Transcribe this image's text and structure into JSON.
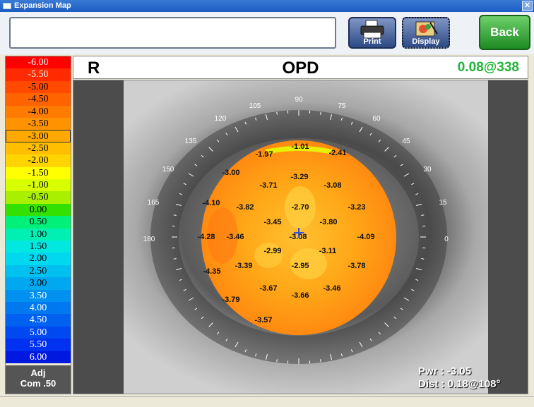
{
  "window": {
    "title": "Expansion Map",
    "close_label": "✕"
  },
  "toolbar": {
    "message": "",
    "print_label": "Print",
    "display_label": "Display",
    "back_label": "Back"
  },
  "header": {
    "eye": "R",
    "mode": "OPD",
    "value": "0.08@338"
  },
  "scale": {
    "selected": "-3.00",
    "items": [
      {
        "label": "-6.00",
        "color": "#ff0000"
      },
      {
        "label": "-5.50",
        "color": "#ff2a00"
      },
      {
        "label": "-5.00",
        "color": "#ff4a00"
      },
      {
        "label": "-4.50",
        "color": "#ff6400"
      },
      {
        "label": "-4.00",
        "color": "#ff7c00"
      },
      {
        "label": "-3.50",
        "color": "#ff9200"
      },
      {
        "label": "-3.00",
        "color": "#ffa800"
      },
      {
        "label": "-2.50",
        "color": "#ffbe00"
      },
      {
        "label": "-2.00",
        "color": "#ffd400"
      },
      {
        "label": "-1.50",
        "color": "#ffff00"
      },
      {
        "label": "-1.00",
        "color": "#d8ff00"
      },
      {
        "label": "-0.50",
        "color": "#a8f000"
      },
      {
        "label": "0.00",
        "color": "#33e000"
      },
      {
        "label": "0.50",
        "color": "#00f07a"
      },
      {
        "label": "1.00",
        "color": "#00f0b4"
      },
      {
        "label": "1.50",
        "color": "#00e8e0"
      },
      {
        "label": "2.00",
        "color": "#00d8f0"
      },
      {
        "label": "2.50",
        "color": "#00c0f0"
      },
      {
        "label": "3.00",
        "color": "#00a8f0"
      },
      {
        "label": "3.50",
        "color": "#0090f0"
      },
      {
        "label": "4.00",
        "color": "#0078f0"
      },
      {
        "label": "4.50",
        "color": "#0060f0"
      },
      {
        "label": "5.00",
        "color": "#0048f0"
      },
      {
        "label": "5.50",
        "color": "#0030f0"
      },
      {
        "label": "6.00",
        "color": "#0018e0"
      }
    ],
    "footer_line1": "Adj",
    "footer_line2": "Com .50"
  },
  "axis_labels": [
    "90",
    "75",
    "60",
    "45",
    "30",
    "15",
    "0",
    "105",
    "120",
    "135",
    "150",
    "165",
    "180"
  ],
  "map_values": [
    "-1.01",
    "-1.97",
    "-2.41",
    "-3.00",
    "-3.29",
    "-3.71",
    "-3.08",
    "-4.10",
    "-3.82",
    "-2.70",
    "-3.23",
    "-3.45",
    "-3.80",
    "-4.28",
    "-3.46",
    "-3.08",
    "-4.09",
    "-2.99",
    "-3.11",
    "-4.35",
    "-3.39",
    "-2.95",
    "-3.78",
    "-3.67",
    "-3.46",
    "-3.79",
    "-3.66",
    "-3.57"
  ],
  "readout": {
    "pwr_label": "Pwr :",
    "pwr_value": "-3.05",
    "dist_label": "Dist :",
    "dist_value": "0.18@108°"
  }
}
